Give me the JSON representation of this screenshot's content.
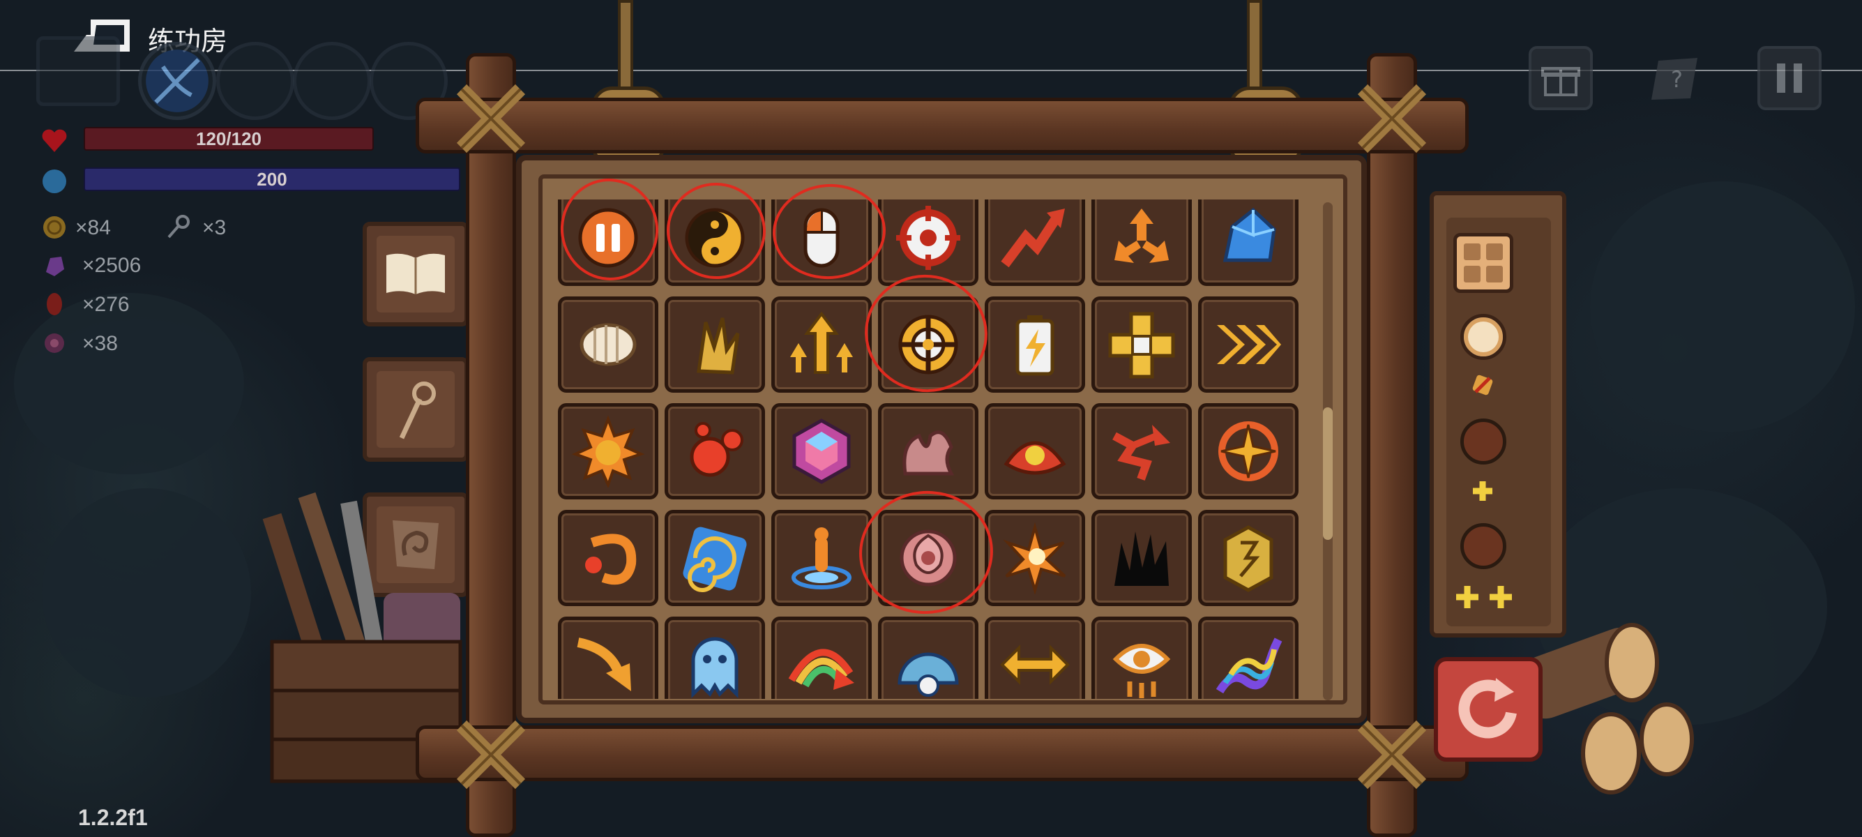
{
  "header": {
    "title": "练功房"
  },
  "stats": {
    "hp": "120/120",
    "mp": "200",
    "coins": "×84",
    "keys": "×3",
    "crystals": "×2506",
    "meat": "×276",
    "gems": "×38"
  },
  "colors": {
    "hp_bar": "#5a1a22",
    "mp_bar": "#2a2a6a",
    "frame_wood": "#5a3522",
    "tile_bg": "#4a2f21",
    "annotation": "#e02b1f",
    "reset": "#c4463e"
  },
  "side_buttons": [
    "book-icon",
    "staff-icon",
    "stone-tablet-icon"
  ],
  "top_right_buttons": [
    "gift-icon",
    "help-book-icon",
    "pause-icon"
  ],
  "skill_grid": [
    [
      "pause-icon",
      "yin-yang-icon",
      "mouse-icon",
      "crosshair-icon",
      "rising-arrow-icon",
      "triple-arrow-icon",
      "blue-crystal-icon"
    ],
    [
      "larva-icon",
      "claw-icon",
      "multi-arrow-icon",
      "target-aim-icon",
      "battery-icon",
      "cross-shield-icon",
      "fast-forward-icon"
    ],
    [
      "sun-icon",
      "red-orb-icon",
      "gem-icon",
      "tentacle-icon",
      "clam-icon",
      "swirl-arrow-icon",
      "compass-icon"
    ],
    [
      "orbit-icon",
      "vortex-icon",
      "fountain-icon",
      "rose-icon",
      "burst-icon",
      "shadow-icon",
      "rune-tablet-icon"
    ],
    [
      "down-arrow-icon",
      "ghost-icon",
      "rainbow-arrow-icon",
      "ice-dome-icon",
      "double-arrow-icon",
      "eye-totem-icon",
      "rainbow-snake-icon"
    ]
  ],
  "right_panel": [
    "grid-icon",
    "ring-slot",
    "mini-skill-icon",
    "slot",
    "plus-icon",
    "slot",
    "double-plus-icon"
  ],
  "version": "1.2.2f1"
}
